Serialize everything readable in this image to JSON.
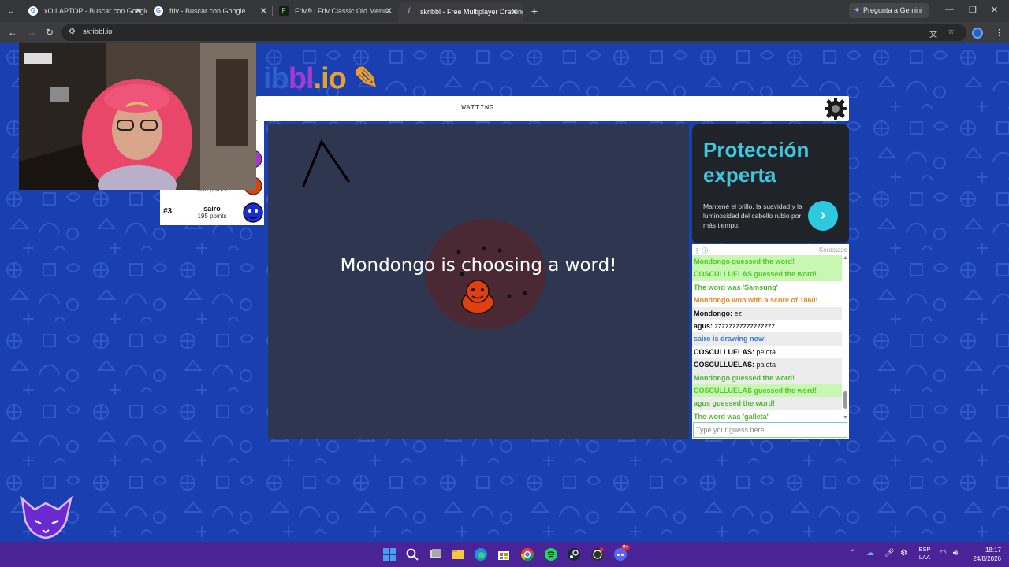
{
  "browser": {
    "tabs": [
      {
        "label": "xO LAPTOP - Buscar con Google",
        "icon": "google-icon",
        "active": false
      },
      {
        "label": "friv - Buscar con Google",
        "icon": "google-icon",
        "active": false
      },
      {
        "label": "Friv® | Friv Classic Old Menu",
        "icon": "friv-icon",
        "active": false
      },
      {
        "label": "skribbl - Free Multiplayer Drawing",
        "icon": "skribbl-icon",
        "active": true
      }
    ],
    "gemini_label": "Pregunta a Gemini",
    "url": "skribbl.io"
  },
  "game": {
    "logo": {
      "part1": "ib",
      "part2": "bl",
      "part3": ".io"
    },
    "status": "WAITING",
    "players": [
      {
        "rank": "",
        "name": "",
        "points": "350 points"
      },
      {
        "rank": "#3",
        "name": "sairo",
        "points": "195 points"
      }
    ],
    "choosing_message": "Mondongo is choosing a word!"
  },
  "ad": {
    "headline_line1": "Protección",
    "headline_line2": "experta",
    "body": "Mantené el brillo, la suavidad y la luminosidad del cabello rubio por más tiempo.",
    "brand": "Kérastase"
  },
  "chat": {
    "messages": [
      {
        "type": "guessed",
        "text": "Mondongo guessed the word!"
      },
      {
        "type": "guessed",
        "text": "COSCULLUELAS guessed the word!"
      },
      {
        "type": "word",
        "text": "The word was 'Samsung'"
      },
      {
        "type": "won",
        "text": "Mondongo won with a score of 1860!"
      },
      {
        "type": "user",
        "author": "Mondongo:",
        "text": "ez"
      },
      {
        "type": "user",
        "author": "agus:",
        "text": "zzzzzzzzzzzzzzzzz"
      },
      {
        "type": "drawing",
        "text": "sairo is drawing now!"
      },
      {
        "type": "user",
        "author": "COSCULLUELAS:",
        "text": "pelota"
      },
      {
        "type": "user",
        "author": "COSCULLUELAS:",
        "text": "paleta"
      },
      {
        "type": "word",
        "text": "Mondongo guessed the word!"
      },
      {
        "type": "guessed",
        "text": "COSCULLUELAS guessed the word!"
      },
      {
        "type": "word",
        "text": "agus guessed the word!"
      },
      {
        "type": "word",
        "text": "The word was 'galleta'"
      }
    ],
    "input_placeholder": "Type your guess here..."
  },
  "taskbar": {
    "lang_line1": "ESP",
    "lang_line2": "LAA",
    "time": "18:17",
    "date": "24/8/2026",
    "discord_badge": "9+"
  },
  "colors": {
    "page_bg": "#1a3fb0",
    "canvas_bg": "#2f3650",
    "guessed_bg": "#c8f7b2",
    "guessed_text": "#50c82a",
    "won_text": "#e88a20",
    "drawing_text": "#3a7ad8",
    "ad_accent": "#2cc9df",
    "taskbar_bg": "#4a2496"
  }
}
